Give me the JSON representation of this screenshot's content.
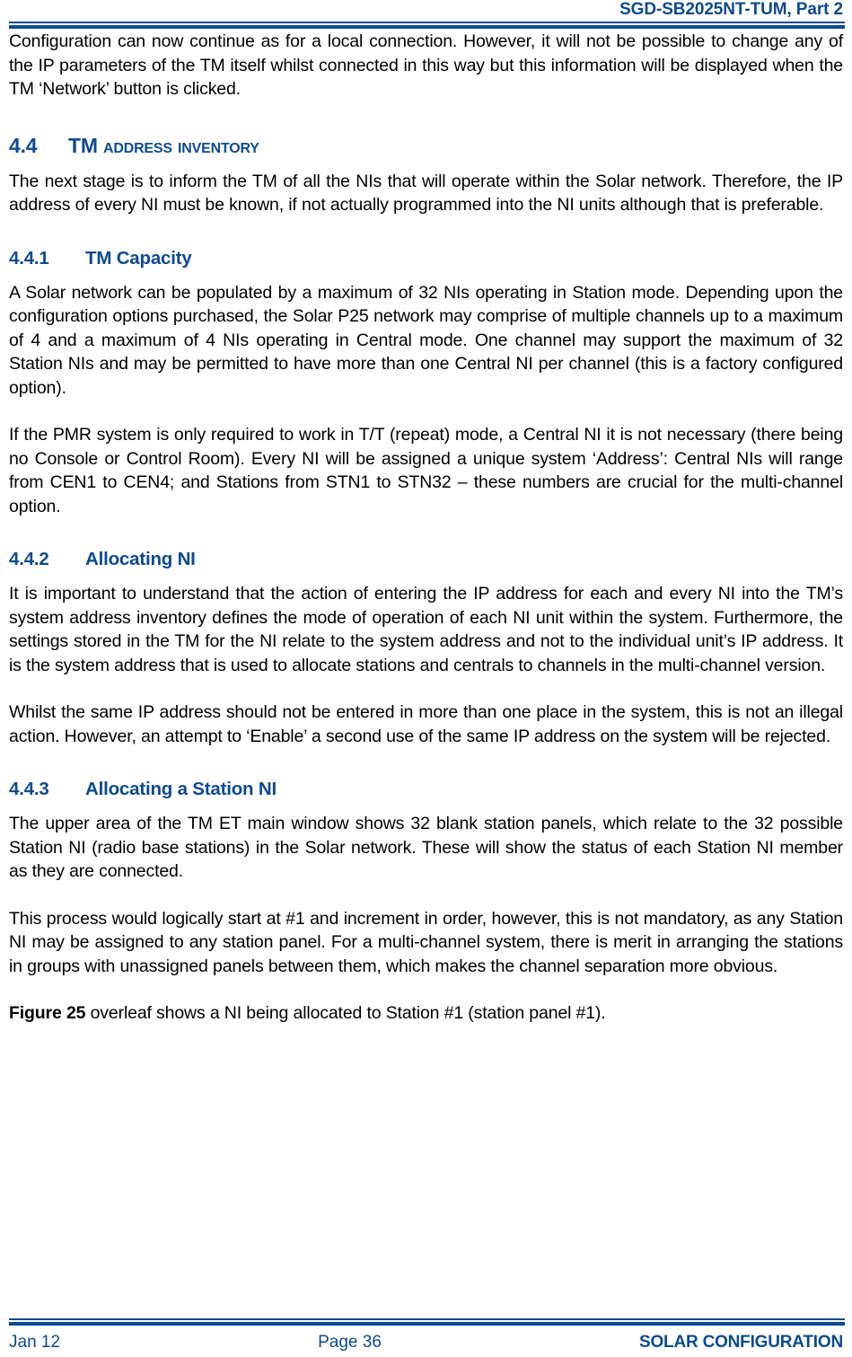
{
  "header": {
    "document_title": "SGD-SB2025NT-TUM, Part 2"
  },
  "content": {
    "intro_paragraph": "Configuration can now continue as for a local connection.  However, it will not be possible to change any of the IP parameters of the TM itself whilst connected in this way but this information will be displayed when the TM ‘Network’ button is clicked.",
    "section_4_4": {
      "number": "4.4",
      "title_lead": "TM",
      "title_rest": "Address Inventory",
      "title_plain": "TM ADDRESS INVENTORY",
      "paragraph": "The next stage is to inform the TM of all the NIs that will operate within the Solar network.  Therefore, the IP address of every NI must be known, if not actually programmed into the NI units although that is preferable."
    },
    "section_4_4_1": {
      "number": "4.4.1",
      "title": "TM Capacity",
      "paragraph_1": "A Solar network can be populated by a maximum of 32 NIs operating in Station mode.  Depending upon the configuration options purchased, the Solar P25 network may comprise of multiple channels up to a maximum of 4 and a maximum of 4 NIs operating in Central mode.  One channel may support the maximum of 32 Station NIs and may be permitted to have more than one Central NI per channel (this is a factory configured option).",
      "paragraph_2": "If the PMR system is only required to work in T/T (repeat) mode, a Central NI it is not necessary (there being no Console or Control Room).  Every NI will be assigned a unique system ‘Address’: Central NIs will range from CEN1 to CEN4; and Stations from STN1 to STN32 – these numbers are crucial for the multi-channel option."
    },
    "section_4_4_2": {
      "number": "4.4.2",
      "title": "Allocating NI",
      "paragraph_1": "It is important to understand that the action of entering the IP address for each and every NI into the TM’s system address inventory defines the mode of operation of each NI unit within the system.  Furthermore, the settings stored in the TM for the NI relate to the system address and not to the individual unit’s IP address.  It is the system address that is used to allocate stations and centrals to channels in the multi-channel version.",
      "paragraph_2": "Whilst the same IP address should not be entered in more than one place in the system, this is not an illegal action.  However, an attempt to ‘Enable’ a second use of the same IP address on the system will be rejected."
    },
    "section_4_4_3": {
      "number": "4.4.3",
      "title": "Allocating a Station NI",
      "paragraph_1": "The upper area of the TM ET main window shows 32 blank station panels, which relate to the 32 possible Station NI (radio base stations) in the Solar network.  These will show the status of each Station NI member as they are connected.",
      "paragraph_2": "This process would logically start at #1 and increment in order, however, this is not mandatory, as any Station NI may be assigned to any station panel.  For a multi-channel system, there is merit in arranging the stations in groups with unassigned panels between them, which makes the channel separation more obvious.",
      "figure_reference_bold": "Figure 25",
      "figure_reference_rest": " overleaf shows a NI being allocated to Station #1 (station panel #1)."
    }
  },
  "footer": {
    "date": "Jan 12",
    "page": "Page 36",
    "section_name": "SOLAR CONFIGURATION"
  },
  "colors": {
    "brand_blue": "#0D4A8F",
    "body_text": "#000000",
    "page_background": "#FFFFFF"
  }
}
